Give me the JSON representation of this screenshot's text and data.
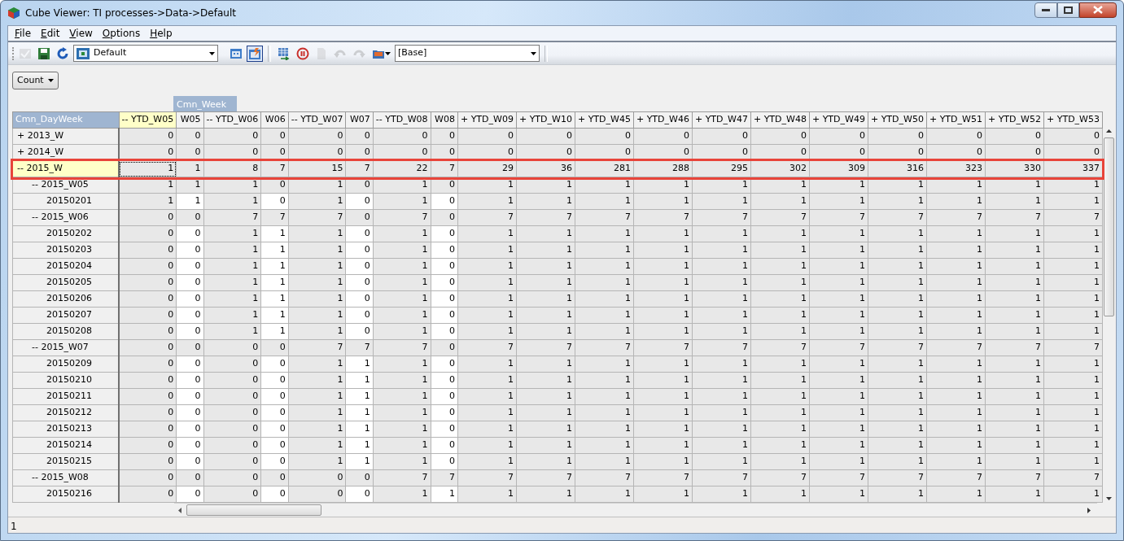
{
  "window": {
    "title": "Cube Viewer: TI processes->Data->Default"
  },
  "menu": [
    {
      "label": "File"
    },
    {
      "label": "Edit"
    },
    {
      "label": "View"
    },
    {
      "label": "Options"
    },
    {
      "label": "Help"
    }
  ],
  "toolbar": {
    "left_buttons": [
      {
        "disabled": true
      },
      {
        "disabled": false
      },
      {
        "disabled": false
      }
    ],
    "view_select": {
      "value": "Default"
    },
    "view_buttons": [
      {
        "pressed": false
      },
      {
        "pressed": true
      }
    ],
    "action_buttons": [
      {
        "disabled": false
      },
      {
        "disabled": false
      },
      {
        "disabled": true
      },
      {
        "disabled": true
      },
      {
        "disabled": true
      },
      {
        "disabled": false
      }
    ],
    "subset_select": {
      "value": "[Base]"
    }
  },
  "measure_select": {
    "value": "Count"
  },
  "column_dimension": "Cmn_Week",
  "row_dimension": "Cmn_DayWeek",
  "columns": [
    {
      "label": "-- YTD_W05",
      "kind": "consolidated",
      "selected": true
    },
    {
      "label": "W05",
      "kind": "leaf",
      "selected": false
    },
    {
      "label": "-- YTD_W06",
      "kind": "consolidated",
      "selected": false
    },
    {
      "label": "W06",
      "kind": "leaf",
      "selected": false
    },
    {
      "label": "-- YTD_W07",
      "kind": "consolidated",
      "selected": false
    },
    {
      "label": "W07",
      "kind": "leaf",
      "selected": false
    },
    {
      "label": "-- YTD_W08",
      "kind": "consolidated",
      "selected": false
    },
    {
      "label": "W08",
      "kind": "leaf",
      "selected": false
    },
    {
      "label": "+ YTD_W09",
      "kind": "consolidated",
      "selected": false
    },
    {
      "label": "+ YTD_W10",
      "kind": "consolidated",
      "selected": false
    },
    {
      "label": "+ YTD_W45",
      "kind": "consolidated",
      "selected": false
    },
    {
      "label": "+ YTD_W46",
      "kind": "consolidated",
      "selected": false
    },
    {
      "label": "+ YTD_W47",
      "kind": "consolidated",
      "selected": false
    },
    {
      "label": "+ YTD_W48",
      "kind": "consolidated",
      "selected": false
    },
    {
      "label": "+ YTD_W49",
      "kind": "consolidated",
      "selected": false
    },
    {
      "label": "+ YTD_W50",
      "kind": "consolidated",
      "selected": false
    },
    {
      "label": "+ YTD_W51",
      "kind": "consolidated",
      "selected": false
    },
    {
      "label": "+ YTD_W52",
      "kind": "consolidated",
      "selected": false
    },
    {
      "label": "+ YTD_W53",
      "kind": "consolidated",
      "selected": false
    }
  ],
  "rows": [
    {
      "label": "+ 2013_W",
      "kind": "consolidated",
      "selected": false,
      "boxed": false,
      "values": [
        "0",
        "0",
        "0",
        "0",
        "0",
        "0",
        "0",
        "0",
        "0",
        "0",
        "0",
        "0",
        "0",
        "0",
        "0",
        "0",
        "0",
        "0",
        "0"
      ]
    },
    {
      "label": "+ 2014_W",
      "kind": "consolidated",
      "selected": false,
      "boxed": false,
      "values": [
        "0",
        "0",
        "0",
        "0",
        "0",
        "0",
        "0",
        "0",
        "0",
        "0",
        "0",
        "0",
        "0",
        "0",
        "0",
        "0",
        "0",
        "0",
        "0"
      ]
    },
    {
      "label": "-- 2015_W",
      "kind": "consolidated",
      "selected": true,
      "boxed": true,
      "values": [
        "1",
        "1",
        "8",
        "7",
        "15",
        "7",
        "22",
        "7",
        "29",
        "36",
        "281",
        "288",
        "295",
        "302",
        "309",
        "316",
        "323",
        "330",
        "337"
      ],
      "children": [
        {
          "label": "-- 2015_W05",
          "kind": "consolidated",
          "selected": false,
          "boxed": false,
          "values": [
            "1",
            "1",
            "1",
            "0",
            "1",
            "0",
            "1",
            "0",
            "1",
            "1",
            "1",
            "1",
            "1",
            "1",
            "1",
            "1",
            "1",
            "1",
            "1"
          ],
          "children": [
            {
              "label": "20150201",
              "kind": "leaf",
              "selected": false,
              "boxed": false,
              "values": [
                "1",
                "1",
                "1",
                "0",
                "1",
                "0",
                "1",
                "0",
                "1",
                "1",
                "1",
                "1",
                "1",
                "1",
                "1",
                "1",
                "1",
                "1",
                "1"
              ]
            }
          ]
        },
        {
          "label": "-- 2015_W06",
          "kind": "consolidated",
          "selected": false,
          "boxed": false,
          "values": [
            "0",
            "0",
            "7",
            "7",
            "7",
            "0",
            "7",
            "0",
            "7",
            "7",
            "7",
            "7",
            "7",
            "7",
            "7",
            "7",
            "7",
            "7",
            "7"
          ],
          "children": [
            {
              "label": "20150202",
              "kind": "leaf",
              "selected": false,
              "boxed": false,
              "values": [
                "0",
                "0",
                "1",
                "1",
                "1",
                "0",
                "1",
                "0",
                "1",
                "1",
                "1",
                "1",
                "1",
                "1",
                "1",
                "1",
                "1",
                "1",
                "1"
              ]
            },
            {
              "label": "20150203",
              "kind": "leaf",
              "selected": false,
              "boxed": false,
              "values": [
                "0",
                "0",
                "1",
                "1",
                "1",
                "0",
                "1",
                "0",
                "1",
                "1",
                "1",
                "1",
                "1",
                "1",
                "1",
                "1",
                "1",
                "1",
                "1"
              ]
            },
            {
              "label": "20150204",
              "kind": "leaf",
              "selected": false,
              "boxed": false,
              "values": [
                "0",
                "0",
                "1",
                "1",
                "1",
                "0",
                "1",
                "0",
                "1",
                "1",
                "1",
                "1",
                "1",
                "1",
                "1",
                "1",
                "1",
                "1",
                "1"
              ]
            },
            {
              "label": "20150205",
              "kind": "leaf",
              "selected": false,
              "boxed": false,
              "values": [
                "0",
                "0",
                "1",
                "1",
                "1",
                "0",
                "1",
                "0",
                "1",
                "1",
                "1",
                "1",
                "1",
                "1",
                "1",
                "1",
                "1",
                "1",
                "1"
              ]
            },
            {
              "label": "20150206",
              "kind": "leaf",
              "selected": false,
              "boxed": false,
              "values": [
                "0",
                "0",
                "1",
                "1",
                "1",
                "0",
                "1",
                "0",
                "1",
                "1",
                "1",
                "1",
                "1",
                "1",
                "1",
                "1",
                "1",
                "1",
                "1"
              ]
            },
            {
              "label": "20150207",
              "kind": "leaf",
              "selected": false,
              "boxed": false,
              "values": [
                "0",
                "0",
                "1",
                "1",
                "1",
                "0",
                "1",
                "0",
                "1",
                "1",
                "1",
                "1",
                "1",
                "1",
                "1",
                "1",
                "1",
                "1",
                "1"
              ]
            },
            {
              "label": "20150208",
              "kind": "leaf",
              "selected": false,
              "boxed": false,
              "values": [
                "0",
                "0",
                "1",
                "1",
                "1",
                "0",
                "1",
                "0",
                "1",
                "1",
                "1",
                "1",
                "1",
                "1",
                "1",
                "1",
                "1",
                "1",
                "1"
              ]
            }
          ]
        },
        {
          "label": "-- 2015_W07",
          "kind": "consolidated",
          "selected": false,
          "boxed": false,
          "values": [
            "0",
            "0",
            "0",
            "0",
            "7",
            "7",
            "7",
            "0",
            "7",
            "7",
            "7",
            "7",
            "7",
            "7",
            "7",
            "7",
            "7",
            "7",
            "7"
          ],
          "children": [
            {
              "label": "20150209",
              "kind": "leaf",
              "selected": false,
              "boxed": false,
              "values": [
                "0",
                "0",
                "0",
                "0",
                "1",
                "1",
                "1",
                "0",
                "1",
                "1",
                "1",
                "1",
                "1",
                "1",
                "1",
                "1",
                "1",
                "1",
                "1"
              ]
            },
            {
              "label": "20150210",
              "kind": "leaf",
              "selected": false,
              "boxed": false,
              "values": [
                "0",
                "0",
                "0",
                "0",
                "1",
                "1",
                "1",
                "0",
                "1",
                "1",
                "1",
                "1",
                "1",
                "1",
                "1",
                "1",
                "1",
                "1",
                "1"
              ]
            },
            {
              "label": "20150211",
              "kind": "leaf",
              "selected": false,
              "boxed": false,
              "values": [
                "0",
                "0",
                "0",
                "0",
                "1",
                "1",
                "1",
                "0",
                "1",
                "1",
                "1",
                "1",
                "1",
                "1",
                "1",
                "1",
                "1",
                "1",
                "1"
              ]
            },
            {
              "label": "20150212",
              "kind": "leaf",
              "selected": false,
              "boxed": false,
              "values": [
                "0",
                "0",
                "0",
                "0",
                "1",
                "1",
                "1",
                "0",
                "1",
                "1",
                "1",
                "1",
                "1",
                "1",
                "1",
                "1",
                "1",
                "1",
                "1"
              ]
            },
            {
              "label": "20150213",
              "kind": "leaf",
              "selected": false,
              "boxed": false,
              "values": [
                "0",
                "0",
                "0",
                "0",
                "1",
                "1",
                "1",
                "0",
                "1",
                "1",
                "1",
                "1",
                "1",
                "1",
                "1",
                "1",
                "1",
                "1",
                "1"
              ]
            },
            {
              "label": "20150214",
              "kind": "leaf",
              "selected": false,
              "boxed": false,
              "values": [
                "0",
                "0",
                "0",
                "0",
                "1",
                "1",
                "1",
                "0",
                "1",
                "1",
                "1",
                "1",
                "1",
                "1",
                "1",
                "1",
                "1",
                "1",
                "1"
              ]
            },
            {
              "label": "20150215",
              "kind": "leaf",
              "selected": false,
              "boxed": false,
              "values": [
                "0",
                "0",
                "0",
                "0",
                "1",
                "1",
                "1",
                "0",
                "1",
                "1",
                "1",
                "1",
                "1",
                "1",
                "1",
                "1",
                "1",
                "1",
                "1"
              ]
            }
          ]
        },
        {
          "label": "-- 2015_W08",
          "kind": "consolidated",
          "selected": false,
          "boxed": false,
          "values": [
            "0",
            "0",
            "0",
            "0",
            "0",
            "0",
            "7",
            "7",
            "7",
            "7",
            "7",
            "7",
            "7",
            "7",
            "7",
            "7",
            "7",
            "7",
            "7"
          ],
          "children": [
            {
              "label": "20150216",
              "kind": "leaf",
              "selected": false,
              "boxed": false,
              "values": [
                "0",
                "0",
                "0",
                "0",
                "0",
                "0",
                "1",
                "1",
                "1",
                "1",
                "1",
                "1",
                "1",
                "1",
                "1",
                "1",
                "1",
                "1",
                "1"
              ]
            }
          ]
        }
      ]
    }
  ],
  "status_bar": {
    "text": "1"
  }
}
